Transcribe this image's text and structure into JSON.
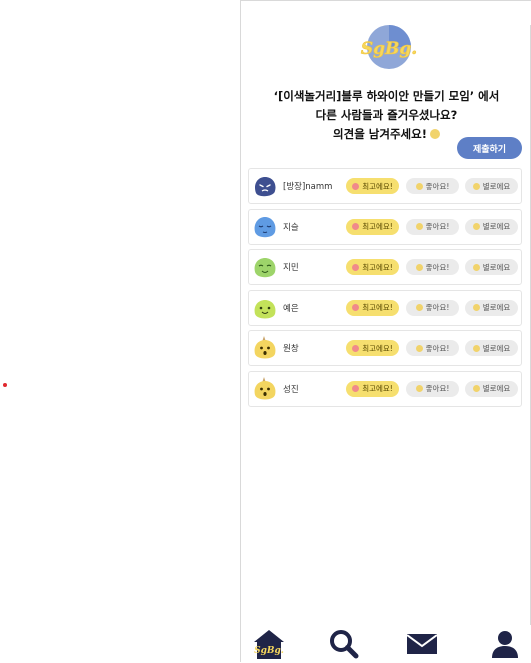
{
  "logo": {
    "text": "SgBg."
  },
  "headline": {
    "line1": "‘[이색놀거리]블루 하와이안 만들기 모임’ 에서",
    "line2": "다른 사람들과 즐거우셨나요?",
    "line3": "의견을 남겨주세요!"
  },
  "submit_label": "제출하기",
  "reactions": {
    "best": "최고에요!",
    "good": "좋아요!",
    "meh": "별로에요"
  },
  "members": [
    {
      "name": "[방장]namm",
      "avatar": "navy-blob-angry-face"
    },
    {
      "name": "지슬",
      "avatar": "blue-blob-sleepy-face"
    },
    {
      "name": "지민",
      "avatar": "green-blob-smile-face"
    },
    {
      "name": "예은",
      "avatar": "lime-blob-smile-face"
    },
    {
      "name": "원창",
      "avatar": "yellow-unicorn-blob-face"
    },
    {
      "name": "성진",
      "avatar": "yellow-unicorn-blob-face"
    }
  ],
  "nav": [
    {
      "name": "home",
      "icon": "house-logo-icon"
    },
    {
      "name": "search",
      "icon": "magnifier-icon"
    },
    {
      "name": "messages",
      "icon": "envelope-icon"
    },
    {
      "name": "profile",
      "icon": "person-icon"
    }
  ],
  "colors": {
    "accent": "#5e7fc6",
    "best_pill": "#f6df6f",
    "neutral_pill": "#ebebeb",
    "nav_dark": "#1f2447"
  }
}
